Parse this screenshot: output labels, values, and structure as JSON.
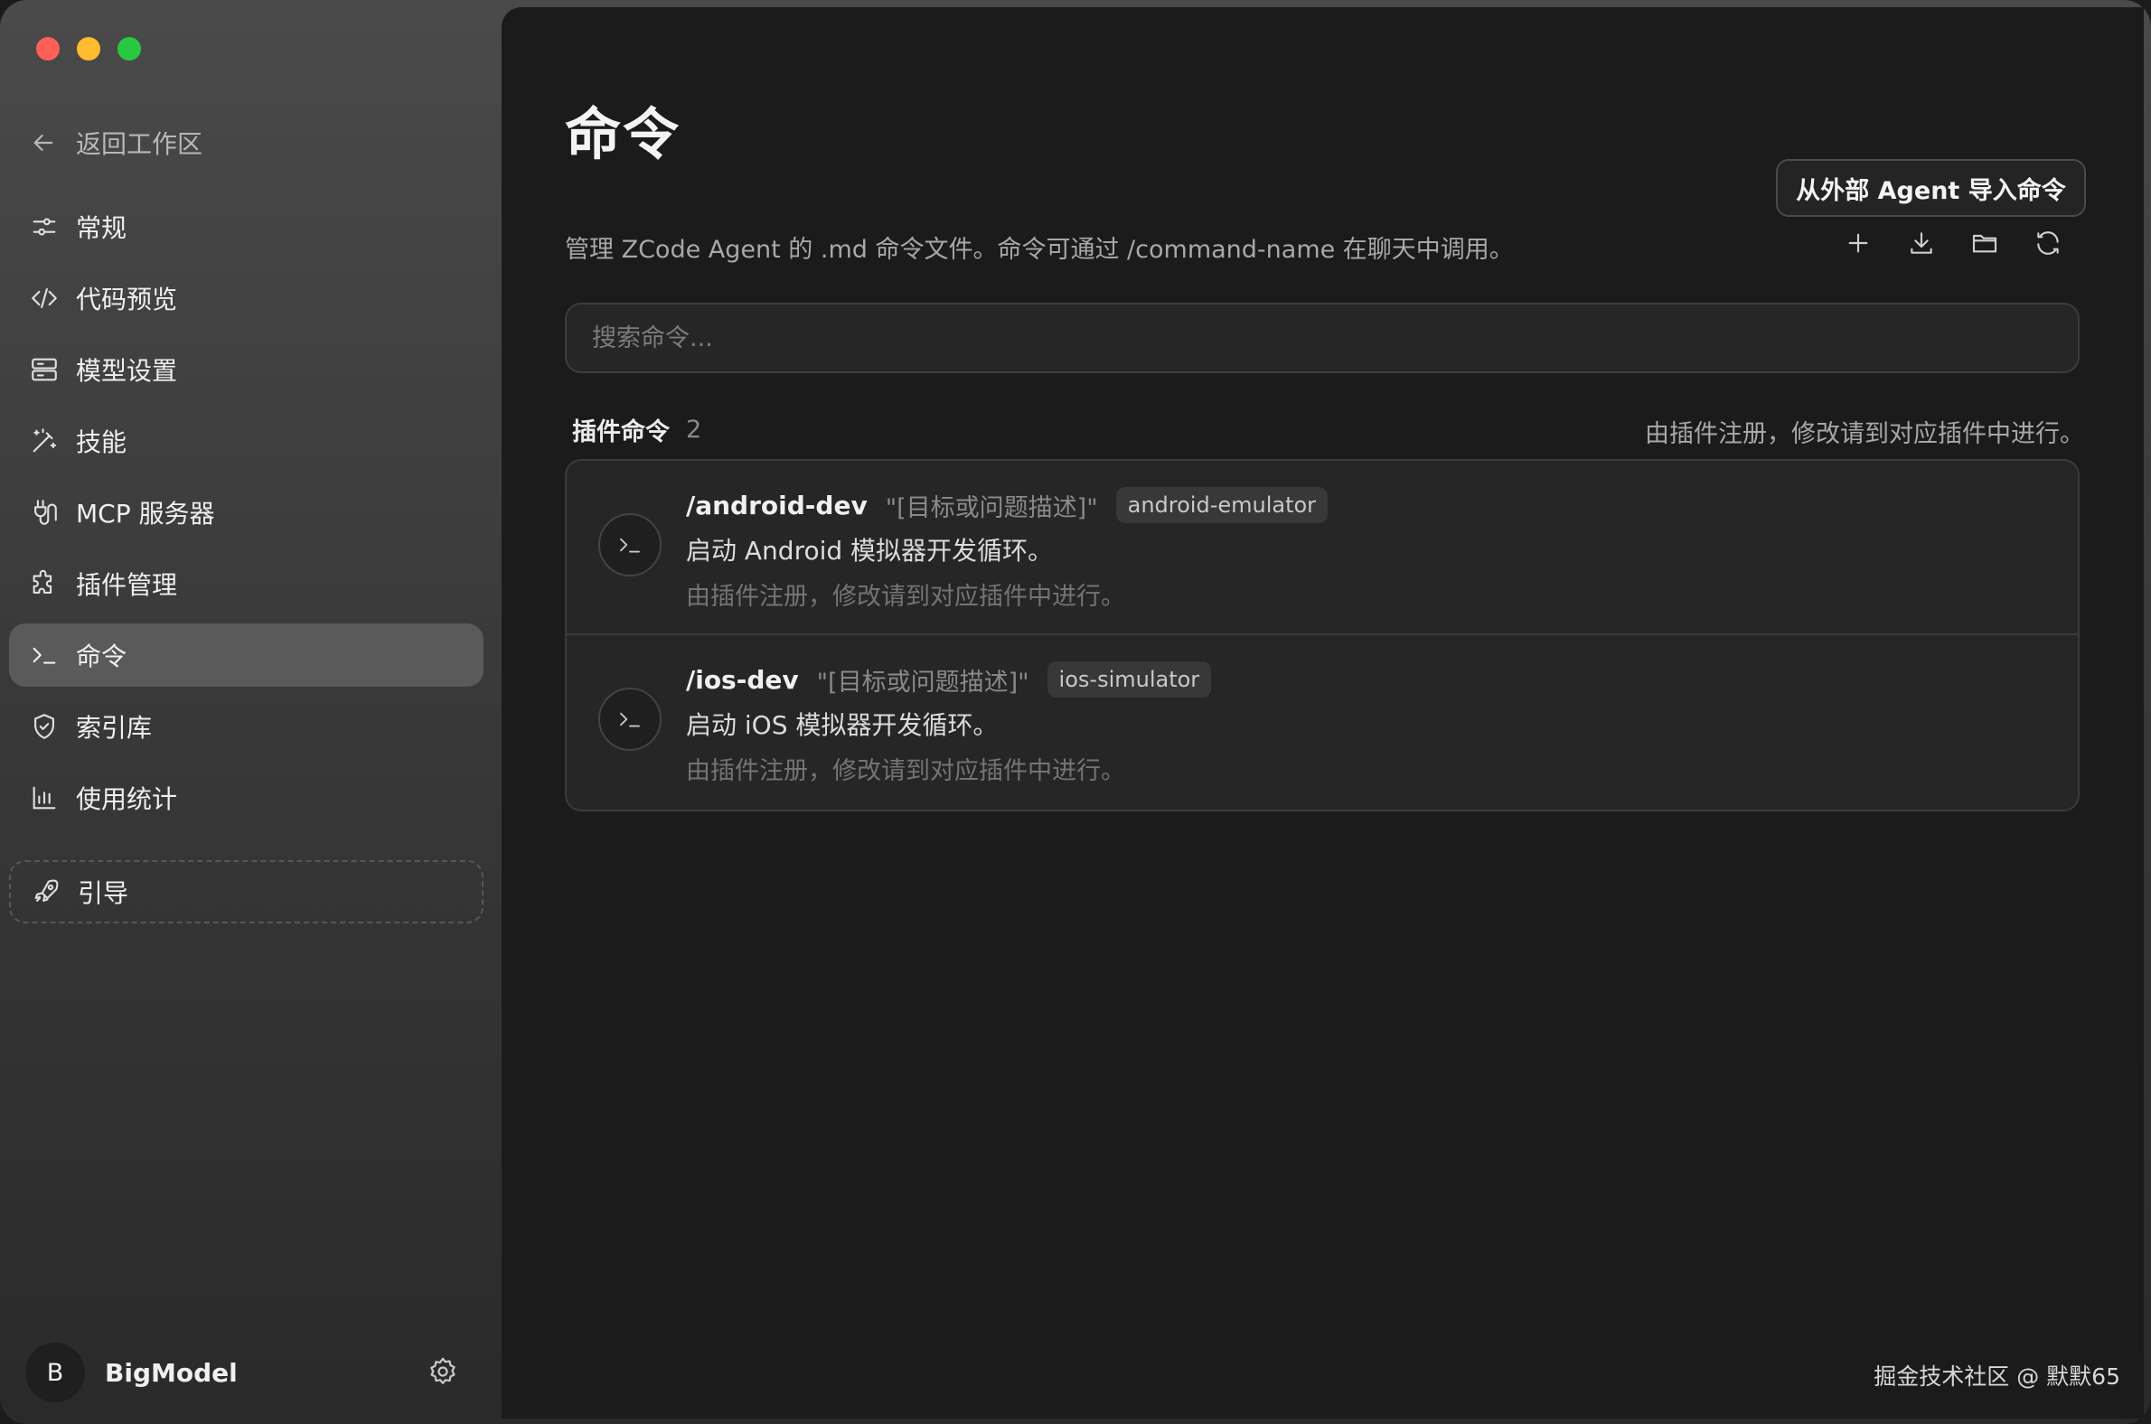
{
  "sidebar": {
    "back_label": "返回工作区",
    "items": [
      {
        "label": "常规",
        "icon": "sliders-icon"
      },
      {
        "label": "代码预览",
        "icon": "code-icon"
      },
      {
        "label": "模型设置",
        "icon": "server-icon"
      },
      {
        "label": "技能",
        "icon": "magic-wand-icon"
      },
      {
        "label": "MCP 服务器",
        "icon": "plug-icon"
      },
      {
        "label": "插件管理",
        "icon": "puzzle-icon"
      },
      {
        "label": "命令",
        "icon": "terminal-icon",
        "active": true
      },
      {
        "label": "索引库",
        "icon": "shield-icon"
      },
      {
        "label": "使用统计",
        "icon": "bar-chart-icon"
      }
    ],
    "guide_label": "引导",
    "user": {
      "initial": "B",
      "name": "BigModel"
    }
  },
  "main": {
    "title": "命令",
    "import_button": "从外部 Agent 导入命令",
    "description": "管理 ZCode Agent 的 .md 命令文件。命令可通过 /command-name 在聊天中调用。",
    "search_placeholder": "搜索命令...",
    "section": {
      "title": "插件命令",
      "count": "2",
      "note": "由插件注册，修改请到对应插件中进行。"
    },
    "commands": [
      {
        "name": "/android-dev",
        "args": "\"[目标或问题描述]\"",
        "tag": "android-emulator",
        "description": "启动 Android 模拟器开发循环。",
        "note": "由插件注册，修改请到对应插件中进行。"
      },
      {
        "name": "/ios-dev",
        "args": "\"[目标或问题描述]\"",
        "tag": "ios-simulator",
        "description": "启动 iOS 模拟器开发循环。",
        "note": "由插件注册，修改请到对应插件中进行。"
      }
    ]
  },
  "watermark": "掘金技术社区 @ 默默65"
}
